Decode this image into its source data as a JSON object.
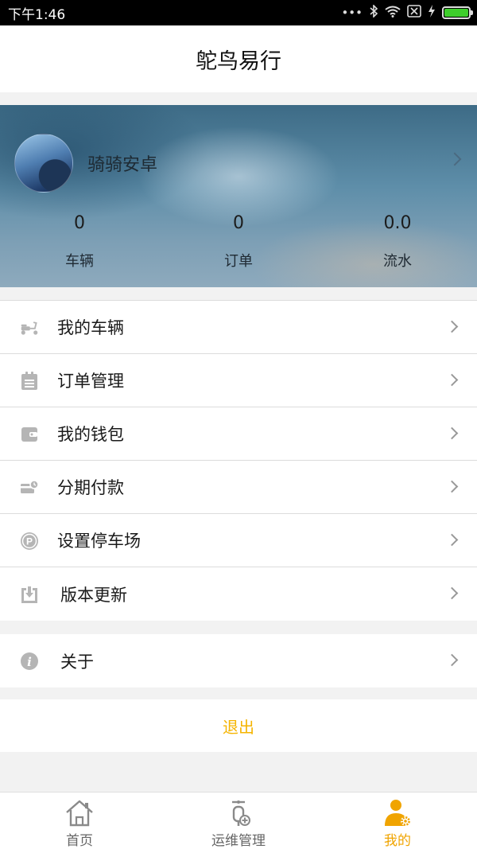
{
  "status_bar": {
    "time": "下午1:46",
    "icons": [
      "more-dots-icon",
      "bluetooth-icon",
      "wifi-icon",
      "no-sim-icon",
      "charging-icon",
      "battery-icon"
    ]
  },
  "header": {
    "title": "鸵鸟易行"
  },
  "profile": {
    "username": "骑骑安卓",
    "stats": [
      {
        "value": "0",
        "label": "车辆"
      },
      {
        "value": "0",
        "label": "订单"
      },
      {
        "value": "0.0",
        "label": "流水"
      }
    ]
  },
  "menu": {
    "items": [
      {
        "label": "我的车辆",
        "icon": "scooter-icon"
      },
      {
        "label": "订单管理",
        "icon": "clipboard-icon"
      },
      {
        "label": "我的钱包",
        "icon": "wallet-icon"
      },
      {
        "label": "分期付款",
        "icon": "installment-icon"
      },
      {
        "label": "设置停车场",
        "icon": "parking-icon"
      },
      {
        "label": "版本更新",
        "icon": "download-icon"
      }
    ],
    "about": {
      "label": "关于",
      "icon": "info-icon"
    }
  },
  "logout": {
    "label": "退出"
  },
  "bottom_nav": {
    "items": [
      {
        "label": "首页",
        "icon": "home-icon",
        "active": false
      },
      {
        "label": "运维管理",
        "icon": "maintenance-icon",
        "active": false
      },
      {
        "label": "我的",
        "icon": "user-settings-icon",
        "active": true
      }
    ]
  },
  "colors": {
    "accent": "#f5b400",
    "background": "#f2f2f2",
    "status_bar": "#000000"
  }
}
